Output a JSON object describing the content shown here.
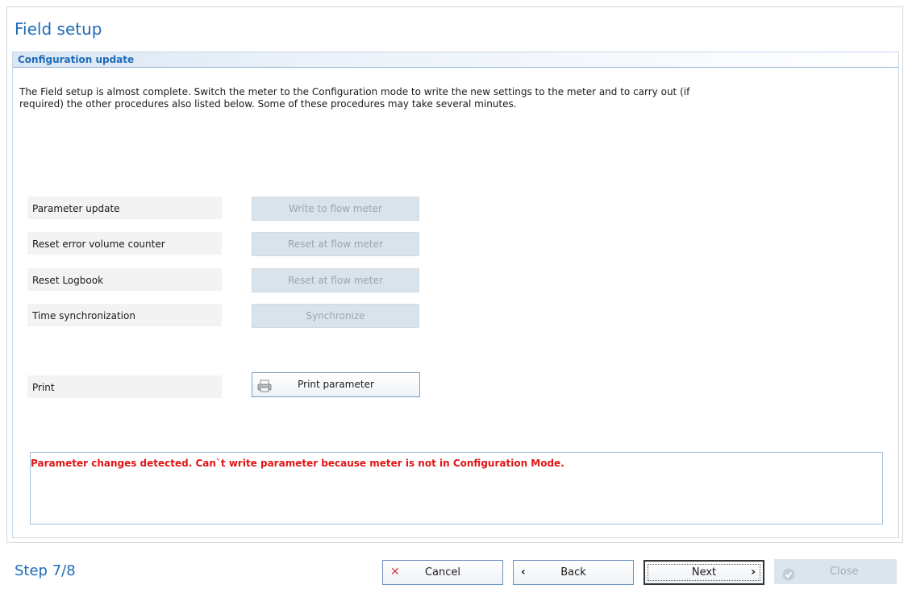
{
  "window": {
    "title": "Field setup"
  },
  "section": {
    "title": "Configuration update",
    "intro_line1": "The Field setup is almost complete.  Switch the meter to the Configuration mode to write the new settings to the meter and to carry out (if",
    "intro_line2": "required) the other procedures also listed below.  Some of these procedures may take several minutes."
  },
  "actions": [
    {
      "label": "Parameter update",
      "button": "Write to flow meter",
      "enabled": false
    },
    {
      "label": "Reset error volume counter",
      "button": "Reset at flow meter",
      "enabled": false
    },
    {
      "label": "Reset Logbook",
      "button": "Reset at flow meter",
      "enabled": false
    },
    {
      "label": "Time synchronization",
      "button": "Synchronize",
      "enabled": false
    }
  ],
  "print": {
    "label": "Print",
    "button": "Print parameter",
    "icon": "printer-icon"
  },
  "message": {
    "text": "Parameter changes detected. Can`t write parameter because meter is not in Configuration Mode.",
    "color": "#e01515"
  },
  "footer": {
    "step": "Step 7/8",
    "cancel": "Cancel",
    "back": "Back",
    "next": "Next",
    "close": "Close",
    "close_enabled": false
  },
  "colors": {
    "accent": "#1e6bb8",
    "disabled_button": "#d8e3ec",
    "error": "#e01515"
  }
}
